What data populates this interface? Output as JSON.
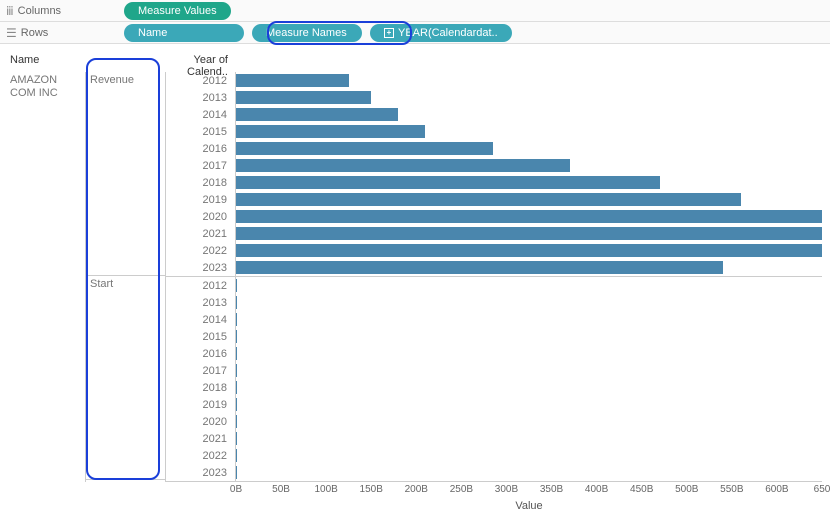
{
  "shelves": {
    "columns_label": "Columns",
    "rows_label": "Rows",
    "pills": {
      "measure_values": "Measure Values",
      "name": "Name",
      "measure_names": "Measure Names",
      "year_calendar": "YEAR(Calendardat.."
    }
  },
  "headers": {
    "name": "Name",
    "year": "Year of Calend.."
  },
  "company": "AMAZON COM INC",
  "measures": {
    "revenue": "Revenue",
    "start": "Start"
  },
  "axis": {
    "title": "Value",
    "ticks": [
      "0B",
      "50B",
      "100B",
      "150B",
      "200B",
      "250B",
      "300B",
      "350B",
      "400B",
      "450B",
      "500B",
      "550B",
      "600B",
      "650"
    ]
  },
  "chart_data": {
    "type": "bar",
    "title": "",
    "xlabel": "Value",
    "ylabel": "Year of Calendar",
    "x_unit": "B",
    "xlim": [
      0,
      650
    ],
    "categories": [
      "2012",
      "2013",
      "2014",
      "2015",
      "2016",
      "2017",
      "2018",
      "2019",
      "2020",
      "2021",
      "2022",
      "2023"
    ],
    "series": [
      {
        "name": "Revenue",
        "values": [
          125,
          150,
          180,
          210,
          285,
          370,
          470,
          560,
          650,
          650,
          650,
          540
        ]
      },
      {
        "name": "Start",
        "values": [
          1,
          1,
          1,
          1,
          1,
          1,
          1,
          1,
          1,
          1,
          1,
          1
        ]
      }
    ]
  }
}
